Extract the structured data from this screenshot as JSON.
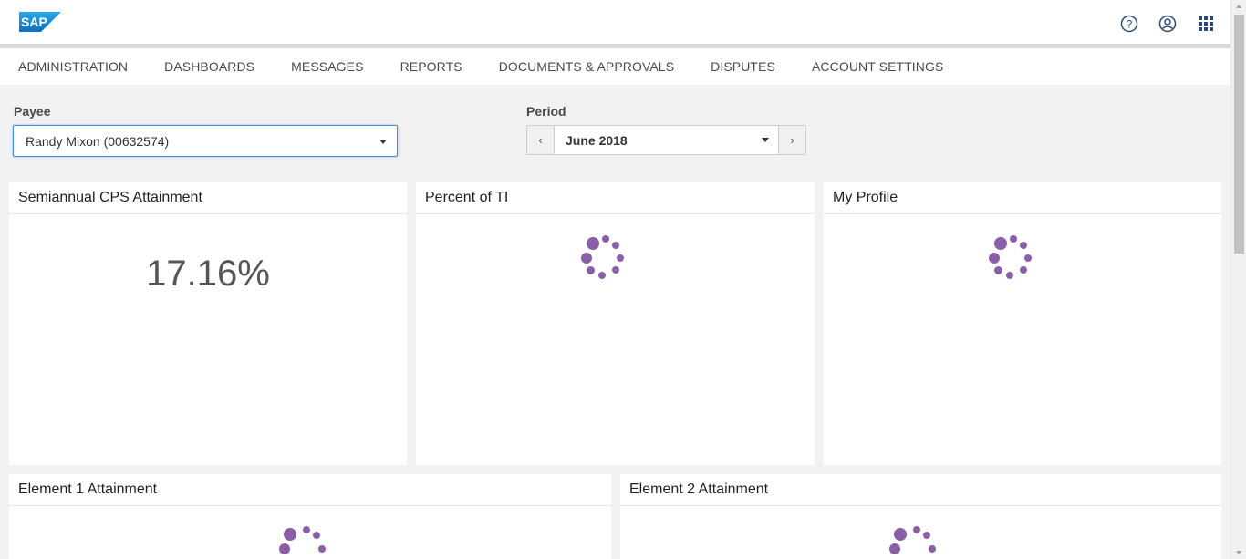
{
  "shell": {
    "logo_text": "SAP",
    "icons": [
      "help-icon",
      "user-profile-icon",
      "app-grid-icon"
    ]
  },
  "nav": {
    "items": [
      "ADMINISTRATION",
      "DASHBOARDS",
      "MESSAGES",
      "REPORTS",
      "DOCUMENTS & APPROVALS",
      "DISPUTES",
      "ACCOUNT SETTINGS"
    ]
  },
  "filters": {
    "payee_label": "Payee",
    "payee_value": "Randy Mixon (00632574)",
    "period_label": "Period",
    "period_value": "June 2018",
    "prev_glyph": "‹",
    "next_glyph": "›"
  },
  "cards": {
    "semiannual": {
      "title": "Semiannual CPS Attainment",
      "value": "17.16%"
    },
    "percent_ti": {
      "title": "Percent of TI",
      "state": "loading"
    },
    "my_profile": {
      "title": "My Profile",
      "state": "loading"
    },
    "element1": {
      "title": "Element 1 Attainment",
      "state": "loading"
    },
    "element2": {
      "title": "Element 2 Attainment",
      "state": "loading"
    }
  },
  "colors": {
    "spinner": "#8b5ea8",
    "sap_blue": "#1d8fd6",
    "focus_border": "#4a90d9"
  }
}
